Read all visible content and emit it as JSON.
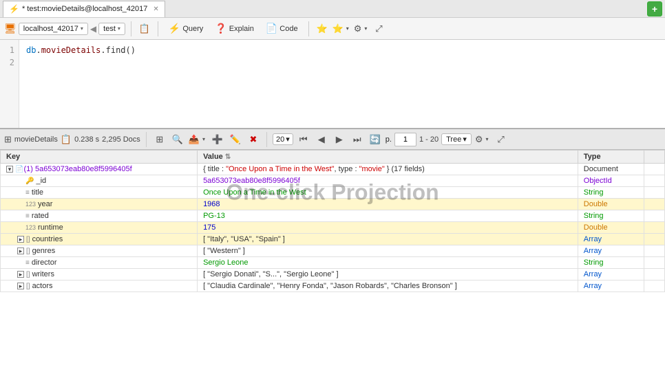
{
  "tab": {
    "label": "* test:movieDetails@localhost_42017",
    "icon": "⚡",
    "close": "✕"
  },
  "add_btn": "+",
  "toolbar": {
    "db_label": "localhost_42017",
    "coll_label": "test",
    "query_label": "Query",
    "explain_label": "Explain",
    "code_label": "Code"
  },
  "editor": {
    "line1": "db.movieDetails.find()",
    "line2": "",
    "line_numbers": [
      "1",
      "2"
    ]
  },
  "results_toolbar": {
    "collection": "movieDetails",
    "time": "0.238 s",
    "docs": "2,295 Docs",
    "page_size": "20",
    "page_num": "1",
    "page_range": "1 - 20",
    "view_mode": "Tree"
  },
  "table": {
    "columns": [
      "Key",
      "Value",
      "Type"
    ],
    "rows": [
      {
        "key": "(1) 5a653073eab80e8f5996405f",
        "value": "{ title : \"Once Upon a Time in the West\", type : \"movie\" } (17 fields)",
        "type": "Document",
        "indent": 0,
        "expanded": true,
        "has_expander": true,
        "highlighted": false,
        "has_key_icon": false,
        "is_doc_row": true
      },
      {
        "key": "_id",
        "value": "5a653073eab80e8f5996405f",
        "type": "ObjectId",
        "indent": 1,
        "highlighted": false,
        "has_key_icon": true,
        "key_icon": "🔑"
      },
      {
        "key": "title",
        "value": "Once Upon a Time in the West",
        "type": "String",
        "indent": 1,
        "highlighted": false,
        "has_key_icon": true,
        "key_icon": "≡"
      },
      {
        "key": "year",
        "value": "1968",
        "type": "Double",
        "indent": 1,
        "highlighted": true,
        "has_key_icon": true,
        "key_icon": "123"
      },
      {
        "key": "rated",
        "value": "PG-13",
        "type": "String",
        "indent": 1,
        "highlighted": false,
        "has_key_icon": true,
        "key_icon": "≡"
      },
      {
        "key": "runtime",
        "value": "175",
        "type": "Double",
        "indent": 1,
        "highlighted": true,
        "has_key_icon": true,
        "key_icon": "123"
      },
      {
        "key": "countries",
        "value": "[ \"Italy\", \"USA\", \"Spain\" ]",
        "type": "Array",
        "indent": 1,
        "highlighted": true,
        "has_key_icon": true,
        "has_expander": true,
        "key_icon": "[]"
      },
      {
        "key": "genres",
        "value": "[ \"Western\" ]",
        "type": "Array",
        "indent": 1,
        "highlighted": false,
        "has_key_icon": true,
        "has_expander": true,
        "key_icon": "[]"
      },
      {
        "key": "director",
        "value": "Sergio Leone",
        "type": "String",
        "indent": 1,
        "highlighted": false,
        "has_key_icon": true,
        "key_icon": "≡"
      },
      {
        "key": "writers",
        "value": "[ \"Sergio Donati\", \"S...\", \"Sergio Leone\" ]",
        "type": "Array",
        "indent": 1,
        "highlighted": false,
        "has_key_icon": true,
        "has_expander": true,
        "key_icon": "[]"
      },
      {
        "key": "actors",
        "value": "[ \"Claudia Cardinale\", \"Henry Fonda\", \"Jason Robards\", \"Charles Bronson\" ]",
        "type": "Array",
        "indent": 1,
        "highlighted": false,
        "has_key_icon": true,
        "has_expander": true,
        "key_icon": "[]"
      }
    ]
  },
  "watermark": "One-click Projection"
}
